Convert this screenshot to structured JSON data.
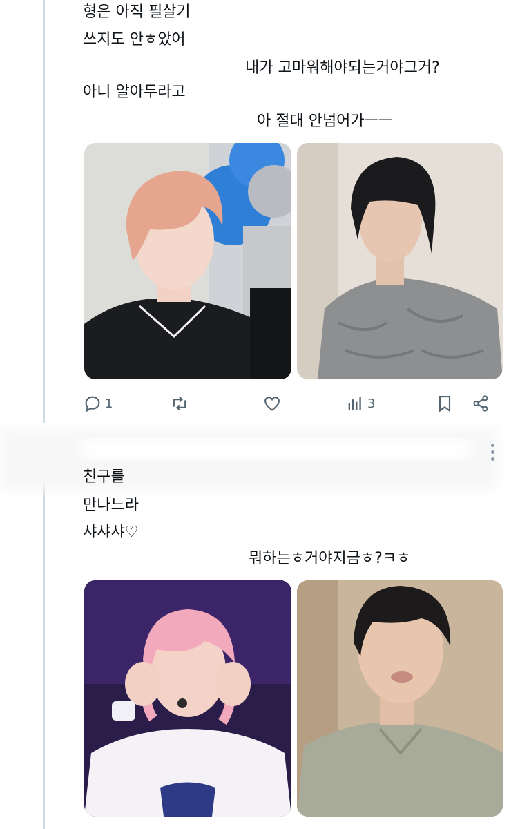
{
  "tweet1": {
    "lines": [
      "형은 아직 필살기",
      "쓰지도 안ㅎ았어",
      "내가 고마워해야되는거야그거?",
      "아니 알아두라고",
      "아 절대 안넘어가ㅡㅡ"
    ],
    "images": [
      "pink-hair-boy-photo",
      "dark-hair-boy-photo"
    ],
    "actions": {
      "reply_count": "1",
      "retweet_count": "",
      "like_count": "",
      "views_count": "3"
    }
  },
  "tweet2": {
    "lines": [
      "친구를",
      "만나느라",
      "샤샤샤♡",
      "뭐하는ㅎ거야지금ㅎ?ㅋㅎ"
    ],
    "images": [
      "pink-hair-performer-photo",
      "dark-hair-boy-closeup-photo"
    ]
  },
  "colors": {
    "text": "#0f1419",
    "icon": "#536471",
    "thread_line": "#cfd9de"
  }
}
